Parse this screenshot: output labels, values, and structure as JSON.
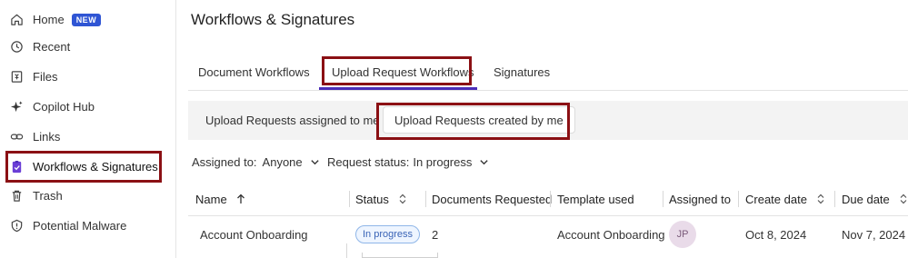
{
  "sidebar": {
    "items": [
      {
        "label": "Home",
        "badge": "NEW",
        "icon": "home-icon"
      },
      {
        "label": "Recent",
        "icon": "clock-icon"
      },
      {
        "label": "Files",
        "icon": "files-icon"
      },
      {
        "label": "Copilot Hub",
        "icon": "sparkle-icon"
      },
      {
        "label": "Links",
        "icon": "link-icon"
      },
      {
        "label": "Workflows & Signatures",
        "icon": "clipboard-check-icon",
        "active": true
      },
      {
        "label": "Trash",
        "icon": "trash-icon"
      },
      {
        "label": "Potential Malware",
        "icon": "shield-alert-icon"
      }
    ]
  },
  "header": {
    "title": "Workflows & Signatures"
  },
  "tabs": [
    {
      "label": "Document Workflows"
    },
    {
      "label": "Upload Request Workflows",
      "active": true
    },
    {
      "label": "Signatures"
    }
  ],
  "subtabs": [
    {
      "label": "Upload Requests assigned to me"
    },
    {
      "label": "Upload Requests created by me",
      "active": true
    }
  ],
  "filters": [
    {
      "label": "Assigned to:",
      "value": "Anyone"
    },
    {
      "label": "Request status:",
      "value": "In progress"
    }
  ],
  "table": {
    "columns": [
      "Name",
      "Status",
      "Documents Requested",
      "Template used",
      "Assigned to",
      "Create date",
      "Due date"
    ],
    "rows": [
      {
        "name": "Account Onboarding",
        "status": "In progress",
        "documents_requested": "2",
        "template_used": "Account Onboarding",
        "assigned_to": "JP",
        "create_date": "Oct 8, 2024",
        "due_date": "Nov 7, 2024"
      }
    ]
  },
  "colors": {
    "accent": "#4b2db8",
    "highlight": "#8b1014",
    "badge": "#2f55d4"
  }
}
